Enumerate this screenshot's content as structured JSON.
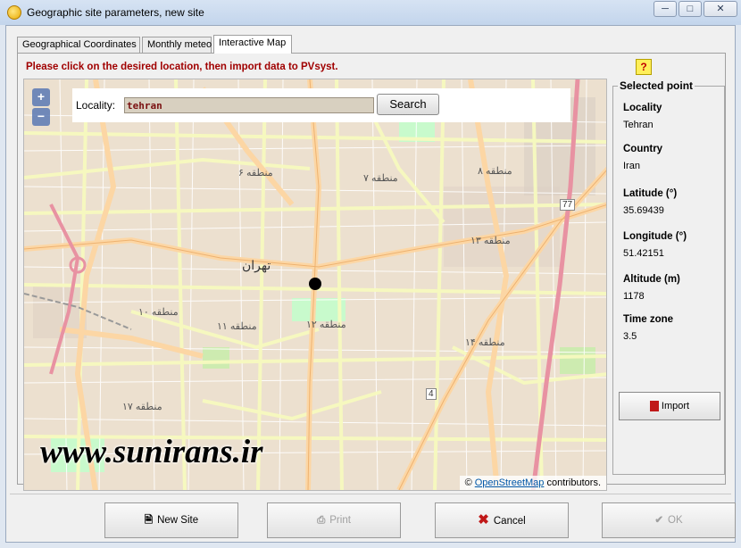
{
  "window": {
    "title": "Geographic site parameters, new site",
    "icons": [
      "app-icon",
      "minimize-icon",
      "maximize-icon",
      "close-icon"
    ]
  },
  "tabs": [
    {
      "label": "Geographical Coordinates",
      "active": false
    },
    {
      "label": "Monthly meteo",
      "active": false
    },
    {
      "label": "Interactive Map",
      "active": true
    }
  ],
  "instruction": "Please click on the desired location, then import data to PVsyst.",
  "help_button": "?",
  "map": {
    "zoom_in": "+",
    "zoom_out": "−",
    "locality_label": "Locality:",
    "locality_value": "tehran",
    "search_label": "Search",
    "attribution_prefix": "©",
    "attribution_link": "OpenStreetMap",
    "attribution_suffix": "contributors.",
    "watermark": "www.sunirans.ir",
    "labels": {
      "city": "تهران",
      "d6": "منطقه ۶",
      "d7": "منطقه ۷",
      "d8": "منطقه ۸",
      "d13": "منطقه ۱۳",
      "d10": "منطقه ۱۰",
      "d11": "منطقه ۱۱",
      "d12": "منطقه ۱۲",
      "d14": "منطقه ۱۴",
      "d17": "منطقه ۱۷",
      "road77": "77",
      "road4": "4"
    }
  },
  "selected_point": {
    "title": "Selected point",
    "fields": [
      {
        "label": "Locality",
        "value": "Tehran"
      },
      {
        "label": "Country",
        "value": "Iran"
      },
      {
        "label": "Latitude (°)",
        "value": "35.69439"
      },
      {
        "label": "Longitude (°)",
        "value": "51.42151"
      },
      {
        "label": "Altitude (m)",
        "value": "1178"
      },
      {
        "label": "Time zone",
        "value": "3.5"
      }
    ],
    "import_label": "Import"
  },
  "buttons": {
    "new_site": "New Site",
    "print": "Print",
    "cancel": "Cancel",
    "ok": "OK"
  },
  "colors": {
    "instruction": "#a00000",
    "map_background": "#ecdfcf",
    "major_road": "#f7fabf",
    "primary_road": "#fcd6a4",
    "park": "#c8facc"
  }
}
